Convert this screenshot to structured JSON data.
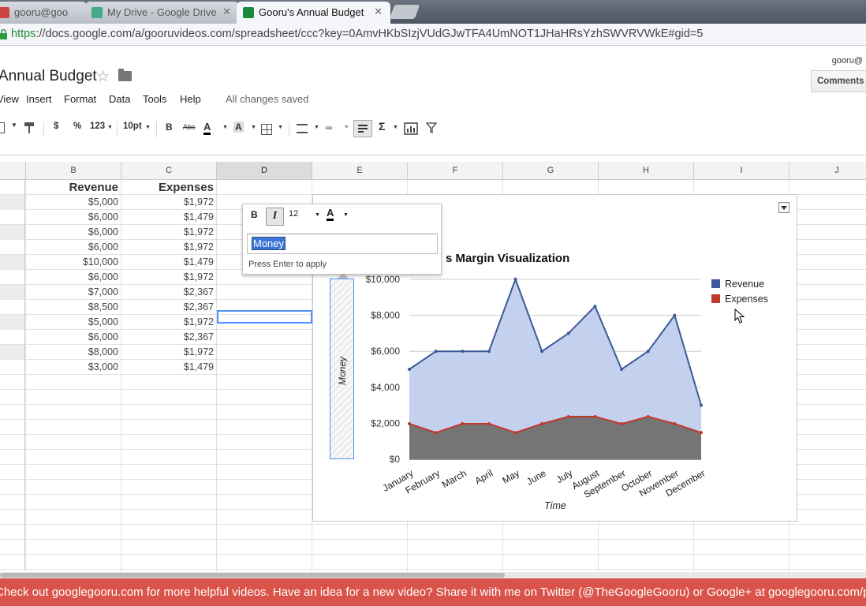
{
  "browser": {
    "tabs": [
      {
        "title": "gooru@goo",
        "active": false
      },
      {
        "title": "My Drive - Google Drive",
        "active": false
      },
      {
        "title": "Gooru's Annual Budget",
        "active": true
      }
    ],
    "url_scheme": "https",
    "url_rest": "://docs.google.com/a/gooruvideos.com/spreadsheet/ccc?key=0AmvHKbSIzjVUdGJwTFA4UmNOT1JHaHRsYzhSWVRVWkE#gid=5"
  },
  "doc": {
    "title": "Annual Budget",
    "user": "gooru@",
    "comments_label": "Comments",
    "save_status": "All changes saved"
  },
  "menu": {
    "items": [
      "View",
      "Insert",
      "Format",
      "Data",
      "Tools",
      "Help"
    ]
  },
  "toolbar": {
    "currency": "$",
    "percent": "%",
    "number_format": "123",
    "font_size": "10pt",
    "bold": "B",
    "strike": "Abc",
    "text_color": "A",
    "fill_color": "A",
    "sum": "Σ"
  },
  "sheet": {
    "columns": [
      "B",
      "C",
      "D",
      "E",
      "F",
      "G",
      "H",
      "I",
      "J"
    ],
    "selected_column": "D",
    "header": {
      "revenue": "Revenue",
      "expenses": "Expenses"
    },
    "revenue": [
      "$5,000",
      "$6,000",
      "$6,000",
      "$6,000",
      "$10,000",
      "$6,000",
      "$7,000",
      "$8,500",
      "$5,000",
      "$6,000",
      "$8,000",
      "$3,000"
    ],
    "expenses": [
      "$1,972",
      "$1,479",
      "$1,972",
      "$1,972",
      "$1,479",
      "$1,972",
      "$2,367",
      "$2,367",
      "$1,972",
      "$2,367",
      "$1,972",
      "$1,479"
    ]
  },
  "popup": {
    "bold": "B",
    "italic": "I",
    "size": "12",
    "color": "A",
    "value": "Money",
    "hint": "Press Enter to apply"
  },
  "chart_data": {
    "type": "area",
    "title": "s Margin Visualization",
    "xlabel": "Time",
    "ylabel": "Money",
    "categories": [
      "January",
      "February",
      "March",
      "April",
      "May",
      "June",
      "July",
      "August",
      "September",
      "October",
      "November",
      "December"
    ],
    "series": [
      {
        "name": "Revenue",
        "values": [
          5000,
          6000,
          6000,
          6000,
          10000,
          6000,
          7000,
          8500,
          5000,
          6000,
          8000,
          3000
        ],
        "color": "#3b5998",
        "fill": "#c4d1ee"
      },
      {
        "name": "Expenses",
        "values": [
          1972,
          1479,
          1972,
          1972,
          1479,
          1972,
          2367,
          2367,
          1972,
          2367,
          1972,
          1479
        ],
        "color": "#c0392b",
        "fill": "#757575"
      }
    ],
    "ylim": [
      0,
      10000
    ],
    "yticks": [
      "$0",
      "$2,000",
      "$4,000",
      "$6,000",
      "$8,000",
      "$10,000"
    ],
    "grid": true,
    "legend": "right"
  },
  "banner": {
    "text": "Check out googlegooru.com for more helpful videos. Have an idea for a new video? Share it with me on Twitter (@TheGoogleGooru) or Google+ at googlegooru.com/plus",
    "color": "#d9534a"
  }
}
